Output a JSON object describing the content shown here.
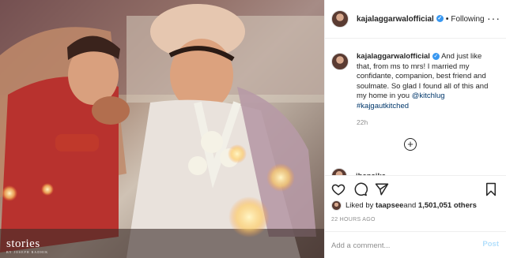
{
  "post": {
    "image_alt": "wedding photo",
    "watermark": "stories",
    "watermark_sub": "BY JOSEPH RADHIK"
  },
  "header": {
    "username": "kajalaggarwalofficial",
    "separator": "•",
    "follow_label": "Following"
  },
  "caption": {
    "username": "kajalaggarwalofficial",
    "text_1": "And just like that, from ms to mrs! I married my confidante, companion, best friend and soulmate. So glad I found all of this and my home in you ",
    "mention": "@kitchlug",
    "hashtag": "#kajgautkitched",
    "timestamp": "22h"
  },
  "comments": {
    "next_user": "ibansika"
  },
  "likes": {
    "prefix": "Liked by ",
    "user": "taapsee",
    "middle": " and ",
    "count": "1,501,051 others"
  },
  "time_ago": "22 HOURS AGO",
  "comment_box": {
    "placeholder": "Add a comment...",
    "post_label": "Post"
  },
  "icons": [
    "heart-icon",
    "comment-icon",
    "share-icon",
    "bookmark-icon",
    "more-options-icon",
    "verified-icon",
    "add-comment-icon"
  ],
  "colors": {
    "link": "#00376b",
    "verified": "#3897f0",
    "muted": "#8e8e8e",
    "post_disabled": "#b2dffc"
  }
}
